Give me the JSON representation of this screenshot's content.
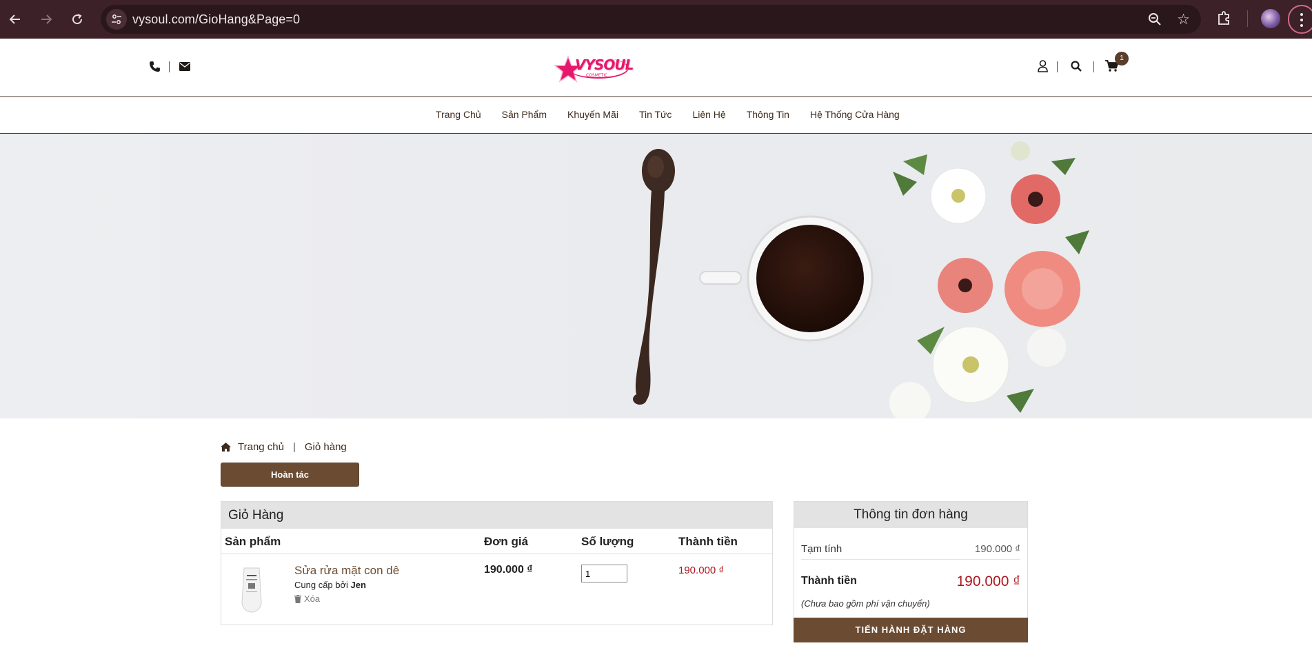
{
  "browser": {
    "url": "vysoul.com/GioHang&Page=0",
    "back_icon": "arrow-left-icon",
    "forward_icon": "arrow-right-icon",
    "reload_icon": "reload-icon"
  },
  "header": {
    "logo_text": "VYSOUL",
    "logo_sub": "COSMETIC",
    "cart_count": "1",
    "accent_color": "#6b4c33"
  },
  "nav": {
    "items": [
      "Trang Chủ",
      "Sản Phẩm",
      "Khuyến Mãi",
      "Tin Tức",
      "Liên Hệ",
      "Thông Tin",
      "Hệ Thống Cửa Hàng"
    ]
  },
  "breadcrumb": {
    "home": "Trang chủ",
    "current": "Giỏ hàng"
  },
  "undo_label": "Hoàn tác",
  "cart": {
    "title": "Giỏ Hàng",
    "columns": {
      "product": "Sản phẩm",
      "unit_price": "Đơn giá",
      "quantity": "Số lượng",
      "total": "Thành tiền"
    },
    "items": [
      {
        "name": "Sửa rửa mặt con dê",
        "supplier_prefix": "Cung cấp bởi",
        "supplier": "Jen",
        "delete_label": "Xóa",
        "unit_price": "190.000 ₫",
        "quantity": "1",
        "total": "190.000 ₫"
      }
    ]
  },
  "summary": {
    "title": "Thông tin đơn hàng",
    "subtotal_label": "Tạm tính",
    "subtotal_value": "190.000 ₫",
    "total_label": "Thành tiền",
    "total_value": "190.000 ₫",
    "note": "(Chưa bao gồm phí vận chuyển)",
    "checkout_label": "TIẾN HÀNH ĐẶT HÀNG"
  },
  "colors": {
    "brand_brown": "#6b4c33",
    "price_red": "#b0151d",
    "logo_pink": "#e5186b",
    "chrome_bg": "#3c2129"
  }
}
